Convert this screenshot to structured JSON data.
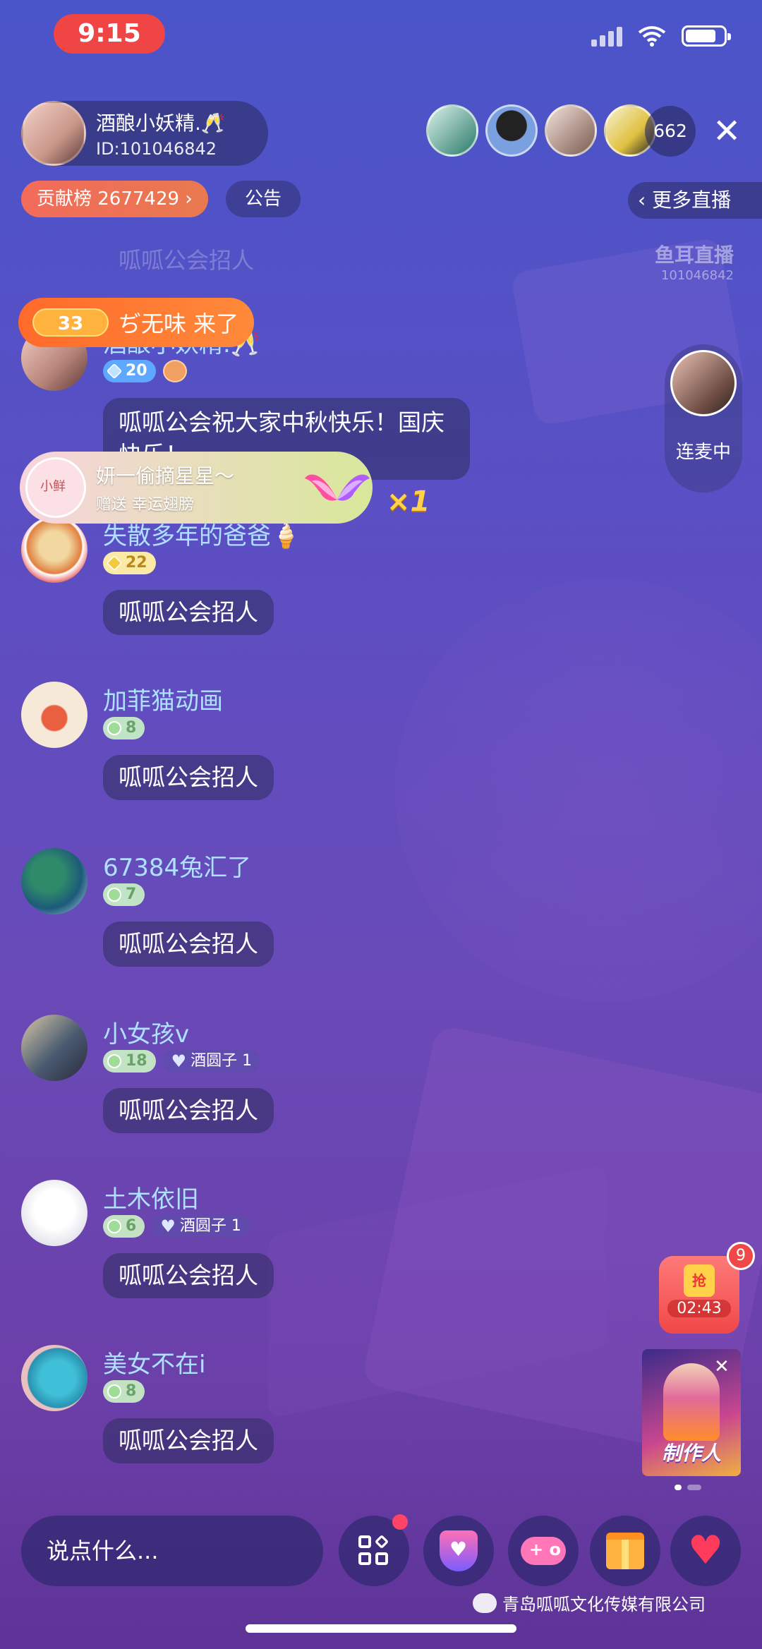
{
  "status_bar": {
    "time": "9:15"
  },
  "host": {
    "name": "酒酿小妖精.🥂",
    "id": "ID:101046842"
  },
  "header": {
    "rank_label": "贡献榜 2677429 ›",
    "notice_label": "公告",
    "viewer_count": "662",
    "close_label": "✕",
    "more_live_label": "‹ 更多直播",
    "watermark_title": "鱼耳直播",
    "watermark_id": "101046842"
  },
  "mic": {
    "label": "连麦中"
  },
  "faded_text": "呱呱公会招人",
  "entry_banner": {
    "level": "33",
    "text": "ぢ无味 来了"
  },
  "gift_banner": {
    "sender": "妍一偷摘星星～",
    "desc": "赠送 幸运翅膀",
    "multiplier": "×1"
  },
  "chat": [
    {
      "name": "酒酿小妖精.🥂",
      "level": "20",
      "level_style": "blue",
      "message": "呱呱公会祝大家中秋快乐！国庆快乐！"
    },
    {
      "name": "失散多年的爸爸🍦",
      "level": "22",
      "level_style": "gold",
      "message": "呱呱公会招人"
    },
    {
      "name": "加菲猫动画",
      "level": "8",
      "level_style": "green",
      "message": "呱呱公会招人"
    },
    {
      "name": "67384兔汇了",
      "level": "7",
      "level_style": "green",
      "message": "呱呱公会招人"
    },
    {
      "name": "小女孩v",
      "level": "18",
      "level_style": "green",
      "club": "酒圆子 1",
      "message": "呱呱公会招人"
    },
    {
      "name": "土木依旧",
      "level": "6",
      "level_style": "green",
      "club": "酒圆子 1",
      "message": "呱呱公会招人"
    },
    {
      "name": "美女不在i",
      "level": "8",
      "level_style": "green",
      "message": "呱呱公会招人"
    }
  ],
  "red_packet": {
    "glyph": "抢",
    "timer": "02:43",
    "count": "9"
  },
  "promo": {
    "title": "制作人",
    "close_label": "✕"
  },
  "bottom": {
    "input_placeholder": "说点什么..."
  },
  "footer_watermark": "青岛呱呱文化传媒有限公司",
  "colors": {
    "name_blue": "#aee0ff",
    "accent_red": "#ef4545",
    "rank_orange": "#f26b5b"
  }
}
